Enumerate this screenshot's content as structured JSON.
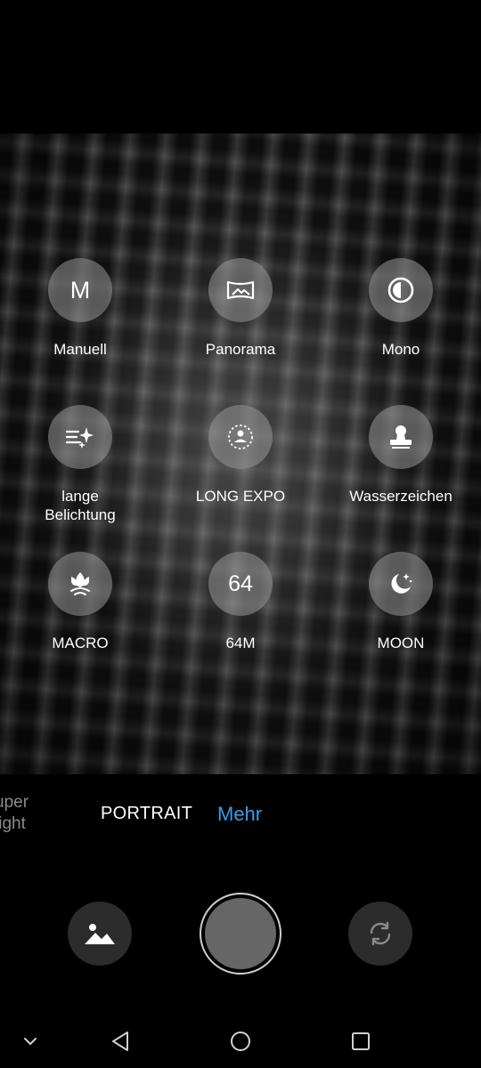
{
  "modes": [
    {
      "id": "manual",
      "label": "Manuell",
      "icon": "letter-m-icon",
      "glyph": "M"
    },
    {
      "id": "panorama",
      "label": "Panorama",
      "icon": "panorama-icon"
    },
    {
      "id": "mono",
      "label": "Mono",
      "icon": "contrast-icon"
    },
    {
      "id": "long-exposure",
      "label": "lange\nBelichtung",
      "icon": "lines-sparkle-icon"
    },
    {
      "id": "long-expo",
      "label": "LONG EXPO",
      "icon": "person-aura-icon"
    },
    {
      "id": "watermark",
      "label": "Wasserzeichen",
      "icon": "stamp-icon"
    },
    {
      "id": "macro",
      "label": "MACRO",
      "icon": "tulip-icon"
    },
    {
      "id": "64m",
      "label": "64M",
      "icon": "number-64-icon",
      "glyph": "64"
    },
    {
      "id": "moon",
      "label": "MOON",
      "icon": "moon-stars-icon"
    }
  ],
  "mode_strip": {
    "cut_off_label": "uper\nlight",
    "portrait_label": "PORTRAIT",
    "more_label": "Mehr",
    "active_color": "#3d9be9"
  },
  "controls": {
    "gallery_icon": "image-icon",
    "switch_icon": "camera-switch-icon"
  },
  "nav": {
    "items": [
      "chevron-down-icon",
      "back-triangle-icon",
      "home-circle-icon",
      "recents-square-icon"
    ]
  }
}
